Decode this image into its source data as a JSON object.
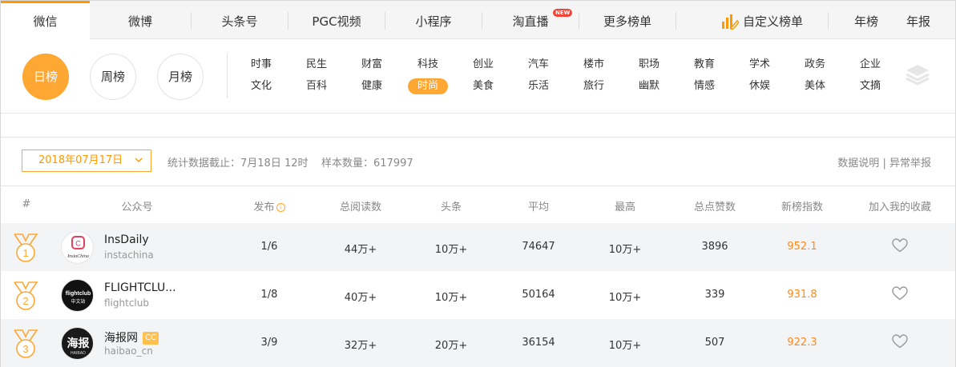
{
  "nav": {
    "tabs": [
      "微信",
      "微博",
      "头条号",
      "PGC视频",
      "小程序",
      "淘直播",
      "更多榜单"
    ],
    "new_badge": "NEW",
    "custom": "自定义榜单",
    "year": "年榜",
    "report": "年报"
  },
  "periods": [
    "日榜",
    "周榜",
    "月榜"
  ],
  "categories": {
    "row1": [
      "时事",
      "民生",
      "财富",
      "科技",
      "创业",
      "汽车",
      "楼市",
      "职场",
      "教育",
      "学术",
      "政务",
      "企业"
    ],
    "row2": [
      "文化",
      "百科",
      "健康",
      "时尚",
      "美食",
      "乐活",
      "旅行",
      "幽默",
      "情感",
      "休娱",
      "美体",
      "文摘"
    ]
  },
  "stats": {
    "date": "2018年07月17日",
    "text": "统计数据截止：7月18日 12时    样本数量：617997",
    "explain": "数据说明",
    "divider": "|",
    "report": "异常举报"
  },
  "table": {
    "headers": [
      "#",
      "公众号",
      "发布",
      "总阅读数",
      "头条",
      "平均",
      "最高",
      "总点赞数",
      "新榜指数",
      "加入我的收藏"
    ],
    "rows": [
      {
        "rank": "1",
        "name": "InsDaily",
        "id": "instachina",
        "avatar_text": "InstaChina",
        "badge": "",
        "publish": "1/6",
        "total_read": "44万+",
        "headline": "10万+",
        "avg": "74647",
        "max": "10万+",
        "likes": "3896",
        "index": "952.1"
      },
      {
        "rank": "2",
        "name": "FLIGHTCLU...",
        "id": "flightclub",
        "avatar_text": "flightclub",
        "avatar_sub": "中文站",
        "badge": "",
        "publish": "1/8",
        "total_read": "40万+",
        "headline": "10万+",
        "avg": "50164",
        "max": "10万+",
        "likes": "339",
        "index": "931.8"
      },
      {
        "rank": "3",
        "name": "海报网",
        "id": "haibao_cn",
        "avatar_text": "海报",
        "avatar_sub": "HAIBAO",
        "badge": "CC",
        "publish": "3/9",
        "total_read": "32万+",
        "headline": "20万+",
        "avg": "36154",
        "max": "10万+",
        "likes": "507",
        "index": "922.3"
      }
    ]
  },
  "colors": {
    "accent": "#ffa733",
    "orange_text": "#ff8a1a"
  }
}
